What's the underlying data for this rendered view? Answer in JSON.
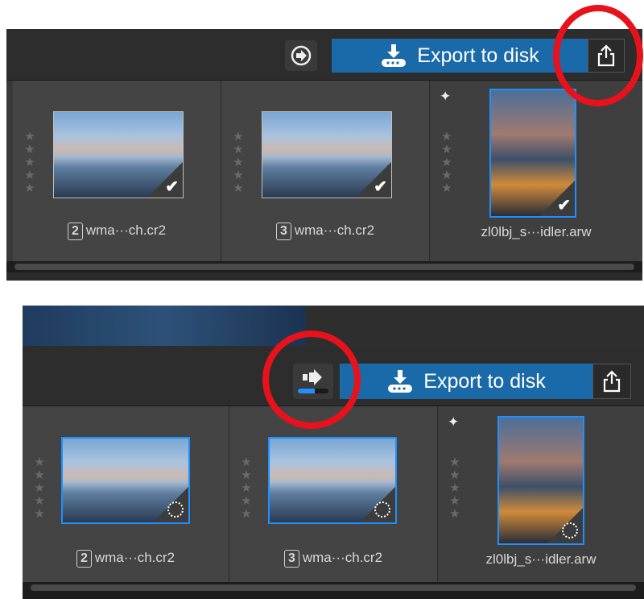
{
  "toolbar": {
    "export_label": "Export to disk",
    "export_icon": "download-disk-icon",
    "share_icon": "share-icon",
    "progress_fraction": 0.55
  },
  "panel_top": {
    "items": [
      {
        "index": "2",
        "name": "wma···ch.cr2",
        "status": "exported"
      },
      {
        "index": "3",
        "name": "wma···ch.cr2",
        "status": "exported"
      },
      {
        "index": "",
        "name": "zl0lbj_s···idler.arw",
        "status": "exported"
      }
    ]
  },
  "panel_bottom": {
    "items": [
      {
        "index": "2",
        "name": "wma···ch.cr2",
        "status": "exporting"
      },
      {
        "index": "3",
        "name": "wma···ch.cr2",
        "status": "exporting"
      },
      {
        "index": "",
        "name": "zl0lbj_s···idler.arw",
        "status": "exporting"
      }
    ]
  },
  "colors": {
    "accent": "#1a6aaa",
    "highlight_ring": "#e8121c",
    "selection": "#1e90ff"
  }
}
